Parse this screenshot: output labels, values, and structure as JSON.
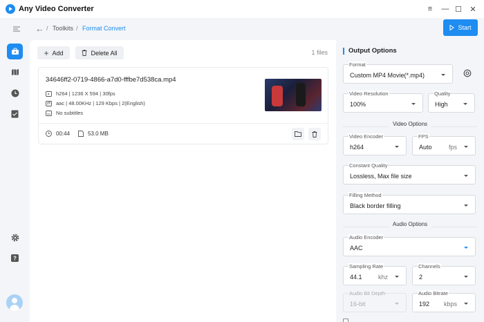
{
  "app": {
    "title": "Any Video Converter"
  },
  "window_controls": {
    "menu": "≡",
    "minimize": "—",
    "maximize": "☐",
    "close": "✕"
  },
  "breadcrumb": {
    "root": "Toolkits",
    "separator": "/",
    "current": "Format Convert"
  },
  "toolbar": {
    "start_label": "Start",
    "add_label": "Add",
    "delete_all_label": "Delete All",
    "files_count": "1 files"
  },
  "file": {
    "name": "34646ff2-0719-4866-a7d0-fffbe7d538ca.mp4",
    "video_info": "h264 | 1236 X 594 | 30fps",
    "audio_info": "aac | 48.00KHz | 129 Kbps | 2(English)",
    "subtitle_info": "No subtitles",
    "duration": "00:44",
    "size": "53.0 MB"
  },
  "options": {
    "title": "Output Options",
    "format": {
      "label": "Format",
      "value": "Custom MP4 Movie(*.mp4)"
    },
    "video_resolution": {
      "label": "Video Resolution",
      "value": "100%"
    },
    "quality": {
      "label": "Quality",
      "value": "High"
    },
    "video_section": "Video Options",
    "video_encoder": {
      "label": "Video Encoder",
      "value": "h264"
    },
    "fps": {
      "label": "FPS",
      "value": "Auto",
      "unit": "fps"
    },
    "constant_quality": {
      "label": "Constant Quality",
      "value": "Lossless, Max file size"
    },
    "filling_method": {
      "label": "Filling Method",
      "value": "Black border filling"
    },
    "audio_section": "Audio Options",
    "audio_encoder": {
      "label": "Audio Encoder",
      "value": "AAC"
    },
    "sampling_rate": {
      "label": "Sampling Rate",
      "value": "44.1",
      "unit": "khz"
    },
    "channels": {
      "label": "Channels",
      "value": "2"
    },
    "audio_bit_depth": {
      "label": "Audio Bit Depth",
      "value": "16-bit"
    },
    "audio_bitrate": {
      "label": "Audio Bitrate",
      "value": "192",
      "unit": "kbps"
    }
  },
  "colors": {
    "accent": "#1e8cf0",
    "panel_bg": "#f3f5f8",
    "card_bg": "#ffffff"
  },
  "icons": {
    "rail": [
      "toolbox-icon",
      "map-icon",
      "clock-icon",
      "checklist-icon",
      "settings-icon",
      "help-icon",
      "avatar-icon"
    ]
  }
}
